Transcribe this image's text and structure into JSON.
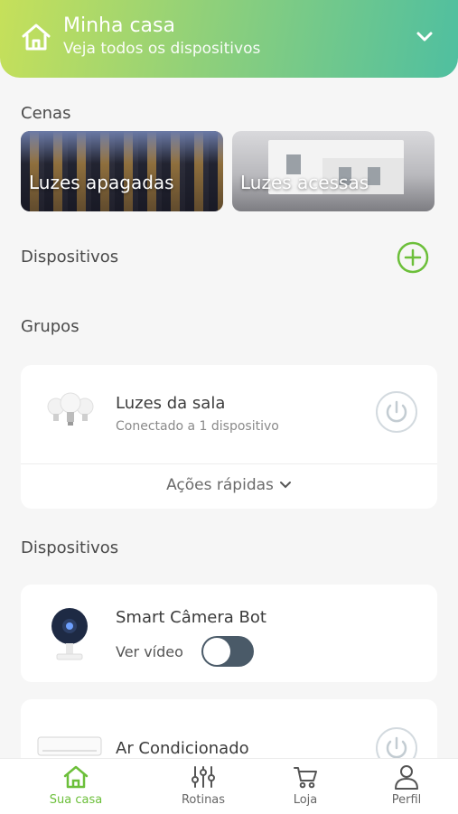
{
  "header": {
    "title": "Minha casa",
    "subtitle": "Veja todos os dispositivos"
  },
  "scenes": {
    "title": "Cenas",
    "items": [
      {
        "label": "Luzes apagadas"
      },
      {
        "label": "Luzes acessas"
      }
    ]
  },
  "devices_header": {
    "title": "Dispositivos"
  },
  "groups": {
    "title": "Grupos",
    "items": [
      {
        "name": "Luzes da sala",
        "status": "Conectado a 1 dispositivo",
        "quick_actions": "Ações rápidas"
      }
    ]
  },
  "devices": {
    "title": "Dispositivos",
    "items": [
      {
        "name": "Smart Câmera Bot",
        "watch_label": "Ver vídeo",
        "toggle_on": false
      },
      {
        "name": "Ar Condicionado"
      }
    ]
  },
  "bottom_nav": {
    "items": [
      {
        "label": "Sua casa",
        "icon": "home-icon",
        "active": true
      },
      {
        "label": "Rotinas",
        "icon": "sliders-icon"
      },
      {
        "label": "Loja",
        "icon": "cart-icon"
      },
      {
        "label": "Perfil",
        "icon": "user-icon"
      }
    ]
  },
  "colors": {
    "accent": "#6cbf3a",
    "header_start": "#c6e05a",
    "header_end": "#4fbfa0",
    "toggle_off": "#4a5a68"
  }
}
